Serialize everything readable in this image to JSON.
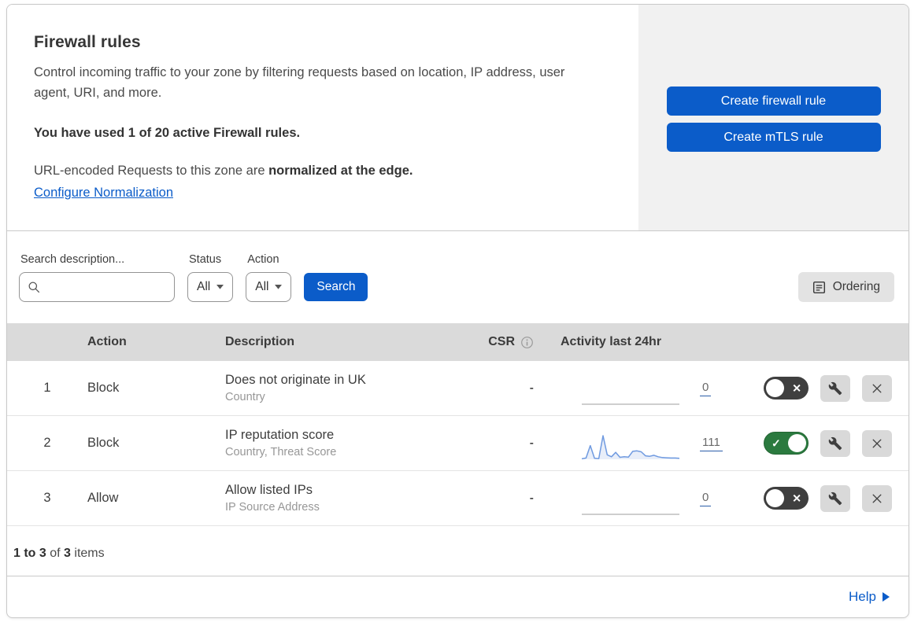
{
  "colors": {
    "accent_blue": "#0b5cc9",
    "toggle_green": "#2b7a3f",
    "toggle_off_gray": "#3f3f3f",
    "sparkline_blue": "#6f9ae0",
    "header_gray": "#dadada",
    "panel_gray": "#f1f1f1"
  },
  "hero": {
    "title": "Firewall rules",
    "description": "Control incoming traffic to your zone by filtering requests based on location, IP address, user agent, URI, and more.",
    "usage_notice": "You have used 1 of 20 active Firewall rules.",
    "normalization_prefix": "URL-encoded Requests to this zone are ",
    "normalization_bold": "normalized at the edge.",
    "normalization_link": "Configure Normalization",
    "create_firewall_button": "Create firewall rule",
    "create_mtls_button": "Create mTLS rule"
  },
  "filters": {
    "search_label": "Search description...",
    "search_value": "",
    "search_placeholder": "",
    "status_label": "Status",
    "status_value": "All",
    "action_label": "Action",
    "action_value": "All",
    "search_button": "Search",
    "ordering_button": "Ordering"
  },
  "table": {
    "headers": {
      "action": "Action",
      "description": "Description",
      "csr": "CSR",
      "activity": "Activity last 24hr"
    },
    "rows": [
      {
        "priority": "1",
        "action": "Block",
        "description": "Does not originate in UK",
        "ruleset": "Country",
        "csr": "-",
        "activity_count": "0",
        "enabled": false,
        "sparkline": []
      },
      {
        "priority": "2",
        "action": "Block",
        "description": "IP reputation score",
        "ruleset": "Country, Threat Score",
        "csr": "-",
        "activity_count": "111",
        "enabled": true,
        "sparkline": [
          2,
          5,
          55,
          4,
          3,
          95,
          18,
          10,
          28,
          8,
          10,
          9,
          32,
          34,
          30,
          14,
          12,
          16,
          10,
          7,
          6,
          5,
          5,
          4
        ]
      },
      {
        "priority": "3",
        "action": "Allow",
        "description": "Allow listed IPs",
        "ruleset": "IP Source Address",
        "csr": "-",
        "activity_count": "0",
        "enabled": false,
        "sparkline": []
      }
    ]
  },
  "footer": {
    "range": "1 to 3",
    "of": " of ",
    "total": "3",
    "items": " items"
  },
  "help": {
    "label": "Help"
  }
}
